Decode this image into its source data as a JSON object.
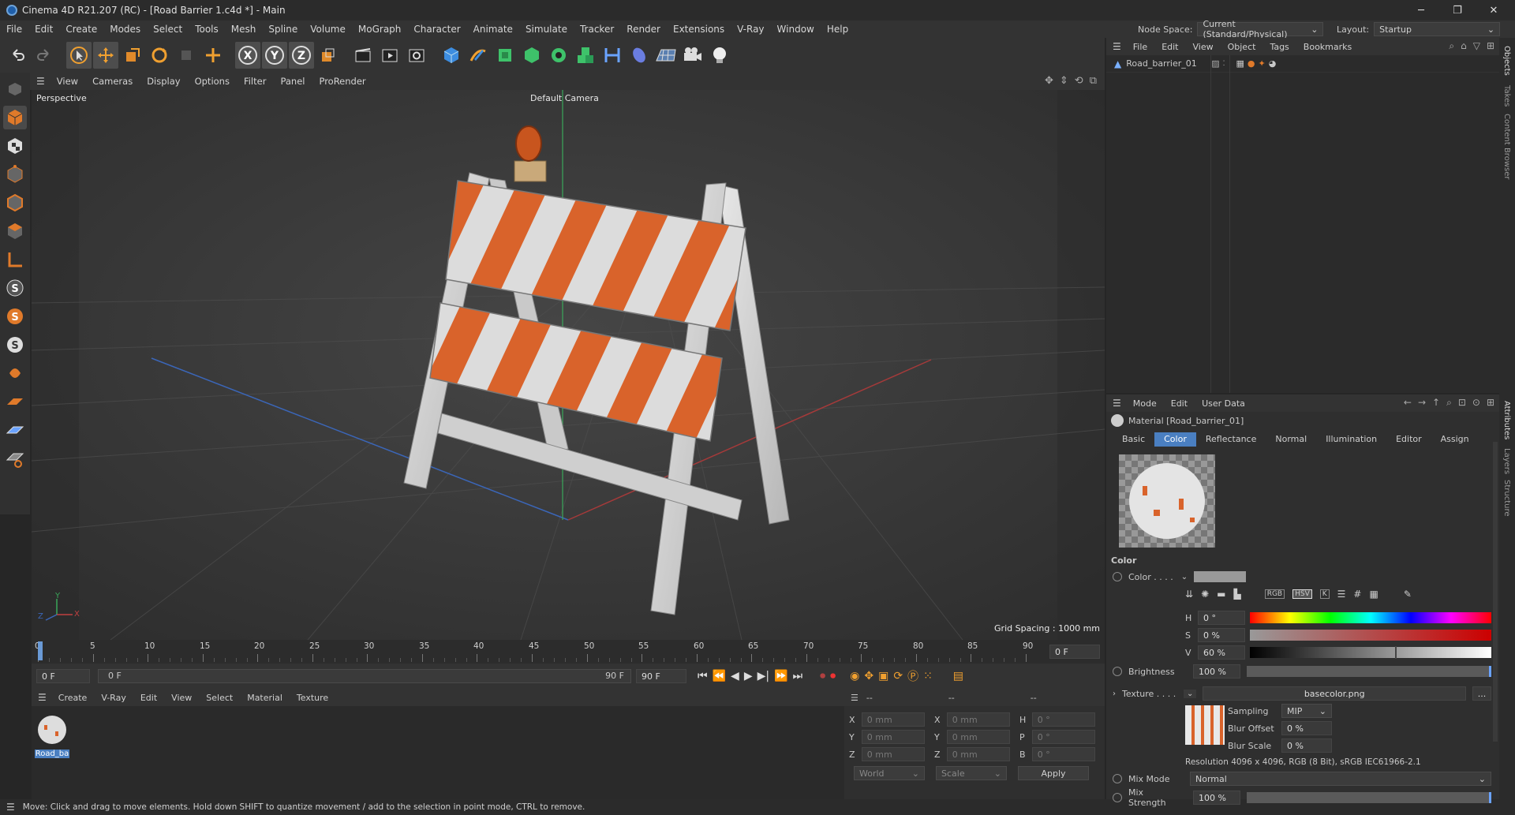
{
  "window": {
    "title": "Cinema 4D R21.207 (RC) - [Road Barrier 1.c4d *] - Main",
    "minimize": "─",
    "maximize": "❐",
    "close": "✕"
  },
  "menu": [
    "File",
    "Edit",
    "Create",
    "Modes",
    "Select",
    "Tools",
    "Mesh",
    "Spline",
    "Volume",
    "MoGraph",
    "Character",
    "Animate",
    "Simulate",
    "Tracker",
    "Render",
    "Extensions",
    "V-Ray",
    "Window",
    "Help"
  ],
  "node_space": {
    "label": "Node Space:",
    "value": "Current (Standard/Physical)"
  },
  "layout": {
    "label": "Layout:",
    "value": "Startup"
  },
  "viewport": {
    "menu": [
      "View",
      "Cameras",
      "Display",
      "Options",
      "Filter",
      "Panel",
      "ProRender"
    ],
    "label": "Perspective",
    "camera": "Default Camera",
    "grid_spacing": "Grid Spacing : 1000 mm",
    "axis_x": "X",
    "axis_y": "Y",
    "axis_z": "Z"
  },
  "timeline": {
    "ticks": [
      "0",
      "5",
      "10",
      "15",
      "20",
      "25",
      "30",
      "35",
      "40",
      "45",
      "50",
      "55",
      "60",
      "65",
      "70",
      "75",
      "80",
      "85",
      "90"
    ],
    "current_frame_display": "0 F"
  },
  "transport": {
    "start": "0 F",
    "range_start": "0 F",
    "range_end": "90 F",
    "end": "90 F"
  },
  "material_manager": {
    "menu": [
      "Create",
      "V-Ray",
      "Edit",
      "View",
      "Select",
      "Material",
      "Texture"
    ],
    "material_name": "Road_ba"
  },
  "coords": {
    "header_left": "--",
    "header_mid": "--",
    "header_right": "--",
    "rows": [
      {
        "a": "X",
        "av": "0 mm",
        "b": "X",
        "bv": "0 mm",
        "c": "H",
        "cv": "0 °"
      },
      {
        "a": "Y",
        "av": "0 mm",
        "b": "Y",
        "bv": "0 mm",
        "c": "P",
        "cv": "0 °"
      },
      {
        "a": "Z",
        "av": "0 mm",
        "b": "Z",
        "bv": "0 mm",
        "c": "B",
        "cv": "0 °"
      }
    ],
    "world": "World",
    "scale": "Scale",
    "apply": "Apply"
  },
  "status": "Move: Click and drag to move elements. Hold down SHIFT to quantize movement / add to the selection in point mode, CTRL to remove.",
  "objects": {
    "menu": [
      "File",
      "Edit",
      "View",
      "Object",
      "Tags",
      "Bookmarks"
    ],
    "item": "Road_barrier_01"
  },
  "sidetabs_top": [
    "Objects",
    "Takes",
    "Content Browser"
  ],
  "sidetabs_bottom": [
    "Attributes",
    "Layers",
    "Structure"
  ],
  "attributes": {
    "menu": [
      "Mode",
      "Edit",
      "User Data"
    ],
    "header": "Material [Road_barrier_01]",
    "tabs": [
      "Basic",
      "Color",
      "Reflectance",
      "Normal",
      "Illumination",
      "Editor",
      "Assign"
    ],
    "section": "Color",
    "color_label": "Color . . . .",
    "h_label": "H",
    "h_value": "0 °",
    "s_label": "S",
    "s_value": "0 %",
    "v_label": "V",
    "v_value": "60 %",
    "v_fraction": 0.6,
    "brightness_label": "Brightness",
    "brightness_value": "100 %",
    "texture_label": "Texture . . . .",
    "texture_file": "basecolor.png",
    "texture_more": "...",
    "sampling_label": "Sampling",
    "sampling_value": "MIP",
    "blur_offset_label": "Blur Offset",
    "blur_offset_value": "0 %",
    "blur_scale_label": "Blur Scale",
    "blur_scale_value": "0 %",
    "resolution": "Resolution 4096 x 4096, RGB (8 Bit), sRGB IEC61966-2.1",
    "mix_mode_label": "Mix Mode",
    "mix_mode_value": "Normal",
    "mix_strength_label": "Mix Strength",
    "mix_strength_value": "100 %",
    "color_mode_buttons": [
      "RGB",
      "HSV",
      "K"
    ]
  },
  "colors": {
    "accent": "#4a7fc1",
    "orange": "#d9632b",
    "bg": "#262626"
  }
}
